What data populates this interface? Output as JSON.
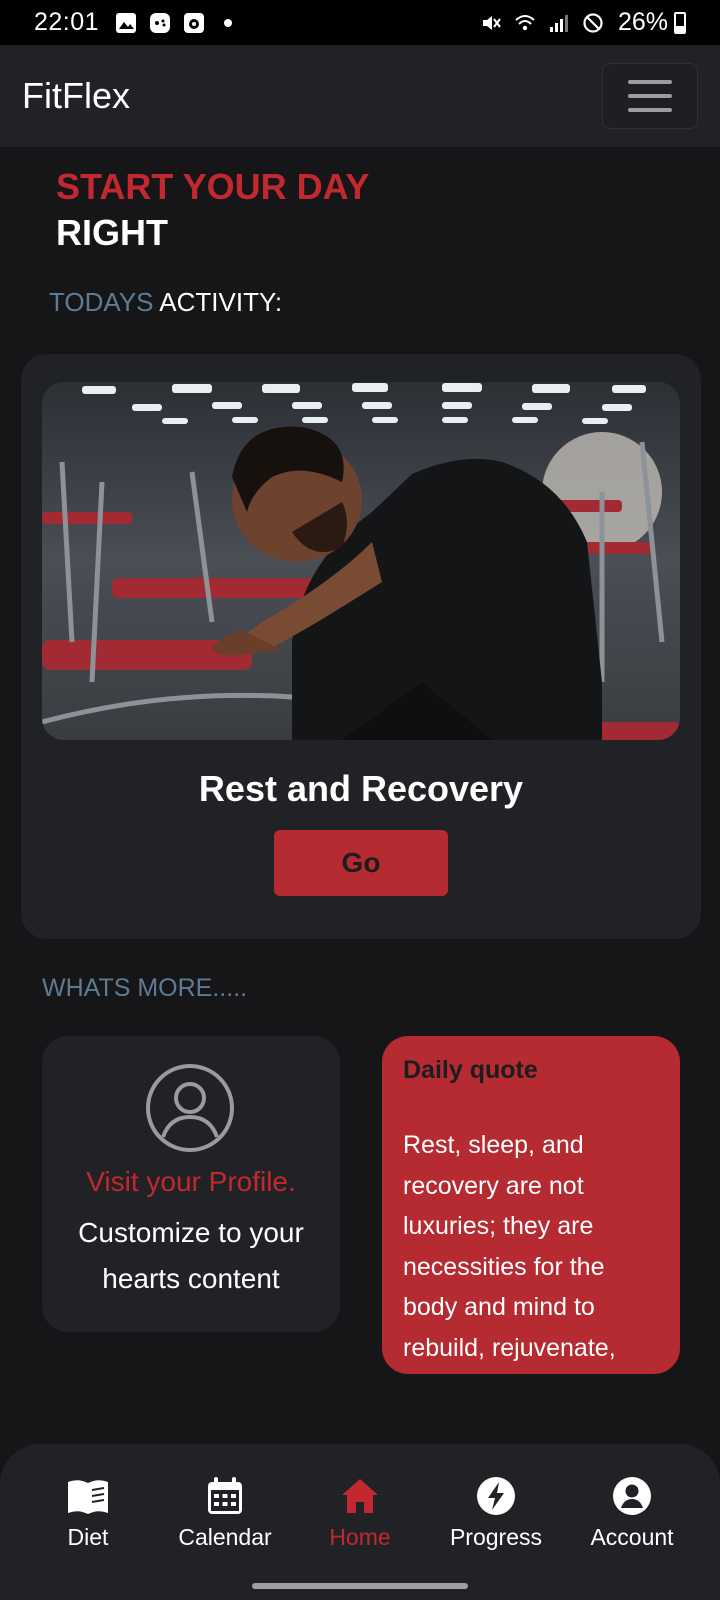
{
  "status_bar": {
    "time": "22:01",
    "battery": "26%"
  },
  "navbar": {
    "brand": "FitFlex"
  },
  "hero": {
    "line1": "START YOUR DAY",
    "line2": "RIGHT"
  },
  "todays": {
    "prefix": "TODAYS",
    "suffix": " ACTIVITY:"
  },
  "activity": {
    "title": "Rest and Recovery",
    "button": "Go"
  },
  "whats_more": "WHATS MORE.....",
  "profile_card": {
    "link": "Visit your Profile.",
    "desc": "Customize to your hearts content"
  },
  "quote_card": {
    "title": "Daily quote",
    "text": "Rest, sleep, and recovery are not luxuries; they are necessities for the body and mind to rebuild, rejuvenate,"
  },
  "bottom_nav": {
    "items": [
      {
        "label": "Diet",
        "icon": "book-icon"
      },
      {
        "label": "Calendar",
        "icon": "calendar-icon"
      },
      {
        "label": "Home",
        "icon": "home-icon",
        "active": true
      },
      {
        "label": "Progress",
        "icon": "bolt-icon"
      },
      {
        "label": "Account",
        "icon": "account-icon"
      }
    ]
  },
  "colors": {
    "accent": "#c1282f",
    "card": "#202226",
    "background": "#161618",
    "muted_blue": "#5e7b95"
  }
}
